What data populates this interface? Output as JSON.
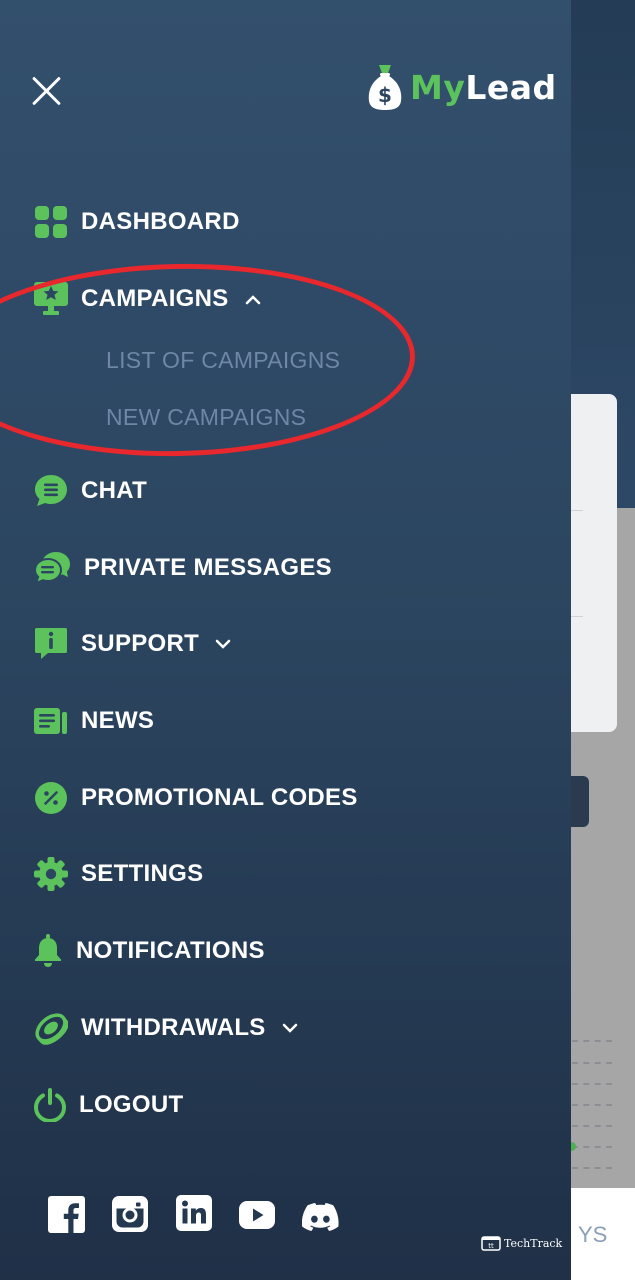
{
  "brand": {
    "logo_my": "My",
    "logo_lead": "Lead",
    "accent": "#5cc35c"
  },
  "menu": {
    "dashboard": "DASHBOARD",
    "campaigns": "CAMPAIGNS",
    "campaigns_sub": {
      "list": "LIST OF CAMPAIGNS",
      "new": "NEW CAMPAIGNS"
    },
    "chat": "CHAT",
    "private_messages": "PRIVATE MESSAGES",
    "support": "SUPPORT",
    "news": "NEWS",
    "promo": "PROMOTIONAL CODES",
    "settings": "SETTINGS",
    "notifications": "NOTIFICATIONS",
    "withdrawals": "WITHDRAWALS",
    "logout": "LOGOUT"
  },
  "social": [
    "facebook-icon",
    "instagram-icon",
    "linkedin-icon",
    "youtube-icon",
    "discord-icon"
  ],
  "background": {
    "footer_fragment": "YS"
  },
  "watermark": "TechTrack"
}
